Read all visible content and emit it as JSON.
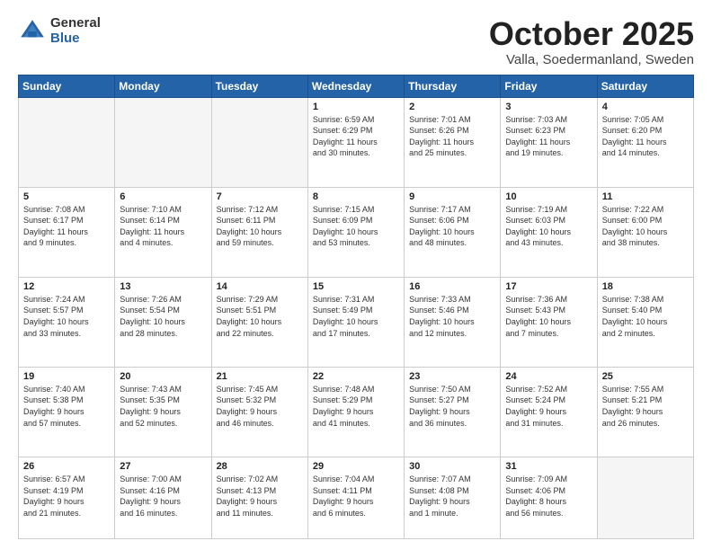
{
  "logo": {
    "general": "General",
    "blue": "Blue"
  },
  "header": {
    "month": "October 2025",
    "location": "Valla, Soedermanland, Sweden"
  },
  "weekdays": [
    "Sunday",
    "Monday",
    "Tuesday",
    "Wednesday",
    "Thursday",
    "Friday",
    "Saturday"
  ],
  "weeks": [
    [
      {
        "day": "",
        "info": ""
      },
      {
        "day": "",
        "info": ""
      },
      {
        "day": "",
        "info": ""
      },
      {
        "day": "1",
        "info": "Sunrise: 6:59 AM\nSunset: 6:29 PM\nDaylight: 11 hours\nand 30 minutes."
      },
      {
        "day": "2",
        "info": "Sunrise: 7:01 AM\nSunset: 6:26 PM\nDaylight: 11 hours\nand 25 minutes."
      },
      {
        "day": "3",
        "info": "Sunrise: 7:03 AM\nSunset: 6:23 PM\nDaylight: 11 hours\nand 19 minutes."
      },
      {
        "day": "4",
        "info": "Sunrise: 7:05 AM\nSunset: 6:20 PM\nDaylight: 11 hours\nand 14 minutes."
      }
    ],
    [
      {
        "day": "5",
        "info": "Sunrise: 7:08 AM\nSunset: 6:17 PM\nDaylight: 11 hours\nand 9 minutes."
      },
      {
        "day": "6",
        "info": "Sunrise: 7:10 AM\nSunset: 6:14 PM\nDaylight: 11 hours\nand 4 minutes."
      },
      {
        "day": "7",
        "info": "Sunrise: 7:12 AM\nSunset: 6:11 PM\nDaylight: 10 hours\nand 59 minutes."
      },
      {
        "day": "8",
        "info": "Sunrise: 7:15 AM\nSunset: 6:09 PM\nDaylight: 10 hours\nand 53 minutes."
      },
      {
        "day": "9",
        "info": "Sunrise: 7:17 AM\nSunset: 6:06 PM\nDaylight: 10 hours\nand 48 minutes."
      },
      {
        "day": "10",
        "info": "Sunrise: 7:19 AM\nSunset: 6:03 PM\nDaylight: 10 hours\nand 43 minutes."
      },
      {
        "day": "11",
        "info": "Sunrise: 7:22 AM\nSunset: 6:00 PM\nDaylight: 10 hours\nand 38 minutes."
      }
    ],
    [
      {
        "day": "12",
        "info": "Sunrise: 7:24 AM\nSunset: 5:57 PM\nDaylight: 10 hours\nand 33 minutes."
      },
      {
        "day": "13",
        "info": "Sunrise: 7:26 AM\nSunset: 5:54 PM\nDaylight: 10 hours\nand 28 minutes."
      },
      {
        "day": "14",
        "info": "Sunrise: 7:29 AM\nSunset: 5:51 PM\nDaylight: 10 hours\nand 22 minutes."
      },
      {
        "day": "15",
        "info": "Sunrise: 7:31 AM\nSunset: 5:49 PM\nDaylight: 10 hours\nand 17 minutes."
      },
      {
        "day": "16",
        "info": "Sunrise: 7:33 AM\nSunset: 5:46 PM\nDaylight: 10 hours\nand 12 minutes."
      },
      {
        "day": "17",
        "info": "Sunrise: 7:36 AM\nSunset: 5:43 PM\nDaylight: 10 hours\nand 7 minutes."
      },
      {
        "day": "18",
        "info": "Sunrise: 7:38 AM\nSunset: 5:40 PM\nDaylight: 10 hours\nand 2 minutes."
      }
    ],
    [
      {
        "day": "19",
        "info": "Sunrise: 7:40 AM\nSunset: 5:38 PM\nDaylight: 9 hours\nand 57 minutes."
      },
      {
        "day": "20",
        "info": "Sunrise: 7:43 AM\nSunset: 5:35 PM\nDaylight: 9 hours\nand 52 minutes."
      },
      {
        "day": "21",
        "info": "Sunrise: 7:45 AM\nSunset: 5:32 PM\nDaylight: 9 hours\nand 46 minutes."
      },
      {
        "day": "22",
        "info": "Sunrise: 7:48 AM\nSunset: 5:29 PM\nDaylight: 9 hours\nand 41 minutes."
      },
      {
        "day": "23",
        "info": "Sunrise: 7:50 AM\nSunset: 5:27 PM\nDaylight: 9 hours\nand 36 minutes."
      },
      {
        "day": "24",
        "info": "Sunrise: 7:52 AM\nSunset: 5:24 PM\nDaylight: 9 hours\nand 31 minutes."
      },
      {
        "day": "25",
        "info": "Sunrise: 7:55 AM\nSunset: 5:21 PM\nDaylight: 9 hours\nand 26 minutes."
      }
    ],
    [
      {
        "day": "26",
        "info": "Sunrise: 6:57 AM\nSunset: 4:19 PM\nDaylight: 9 hours\nand 21 minutes."
      },
      {
        "day": "27",
        "info": "Sunrise: 7:00 AM\nSunset: 4:16 PM\nDaylight: 9 hours\nand 16 minutes."
      },
      {
        "day": "28",
        "info": "Sunrise: 7:02 AM\nSunset: 4:13 PM\nDaylight: 9 hours\nand 11 minutes."
      },
      {
        "day": "29",
        "info": "Sunrise: 7:04 AM\nSunset: 4:11 PM\nDaylight: 9 hours\nand 6 minutes."
      },
      {
        "day": "30",
        "info": "Sunrise: 7:07 AM\nSunset: 4:08 PM\nDaylight: 9 hours\nand 1 minute."
      },
      {
        "day": "31",
        "info": "Sunrise: 7:09 AM\nSunset: 4:06 PM\nDaylight: 8 hours\nand 56 minutes."
      },
      {
        "day": "",
        "info": ""
      }
    ]
  ]
}
